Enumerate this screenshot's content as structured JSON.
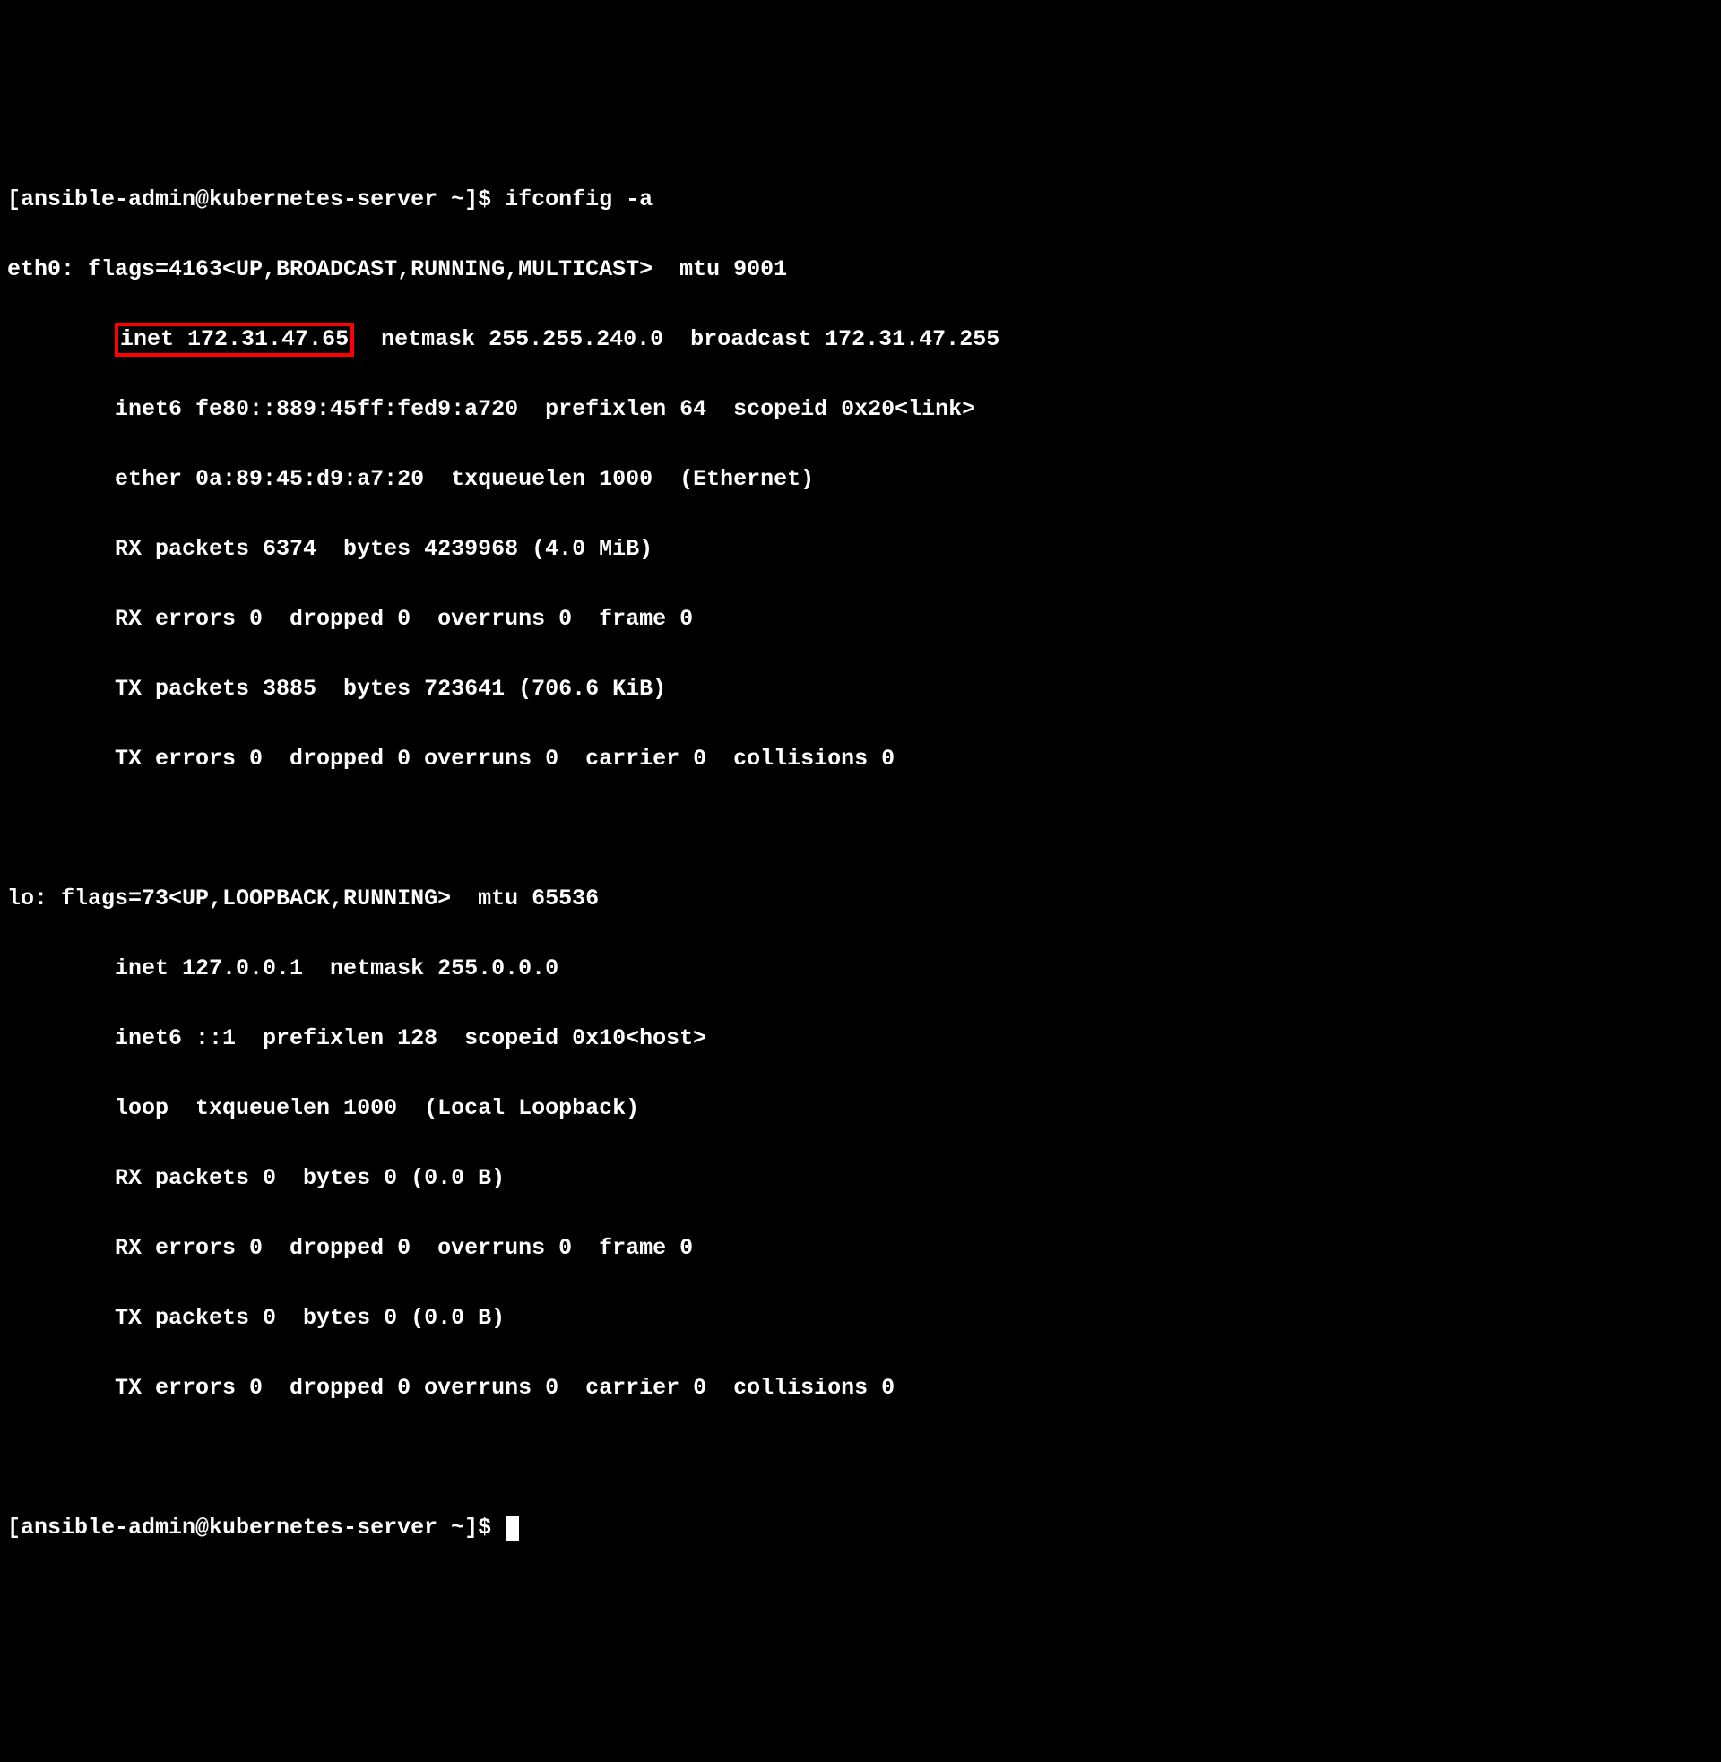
{
  "prompt1_prefix": "[ansible-admin@kubernetes-server ~]$ ",
  "command": "ifconfig -a",
  "eth0": {
    "header": "eth0: flags=4163<UP,BROADCAST,RUNNING,MULTICAST>  mtu 9001",
    "inet_label": "inet 172.31.47.65",
    "inet_rest": "  netmask 255.255.240.0  broadcast 172.31.47.255",
    "inet6": "        inet6 fe80::889:45ff:fed9:a720  prefixlen 64  scopeid 0x20<link>",
    "ether": "        ether 0a:89:45:d9:a7:20  txqueuelen 1000  (Ethernet)",
    "rx_packets": "        RX packets 6374  bytes 4239968 (4.0 MiB)",
    "rx_errors": "        RX errors 0  dropped 0  overruns 0  frame 0",
    "tx_packets": "        TX packets 3885  bytes 723641 (706.6 KiB)",
    "tx_errors": "        TX errors 0  dropped 0 overruns 0  carrier 0  collisions 0"
  },
  "lo": {
    "header": "lo: flags=73<UP,LOOPBACK,RUNNING>  mtu 65536",
    "inet": "        inet 127.0.0.1  netmask 255.0.0.0",
    "inet6": "        inet6 ::1  prefixlen 128  scopeid 0x10<host>",
    "loop": "        loop  txqueuelen 1000  (Local Loopback)",
    "rx_packets": "        RX packets 0  bytes 0 (0.0 B)",
    "rx_errors": "        RX errors 0  dropped 0  overruns 0  frame 0",
    "tx_packets": "        TX packets 0  bytes 0 (0.0 B)",
    "tx_errors": "        TX errors 0  dropped 0 overruns 0  carrier 0  collisions 0"
  },
  "prompt2": "[ansible-admin@kubernetes-server ~]$ ",
  "indent_inet": "        "
}
